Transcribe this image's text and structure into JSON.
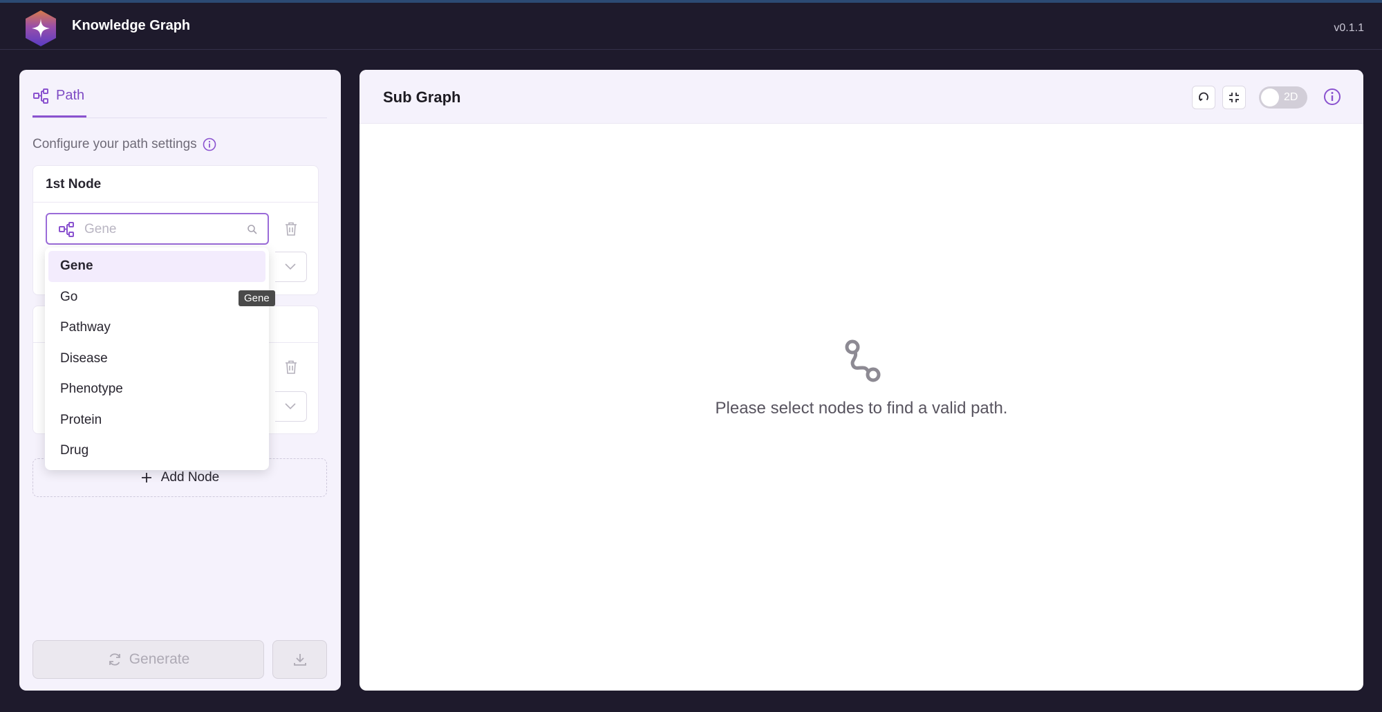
{
  "app": {
    "title": "Knowledge Graph",
    "version": "v0.1.1"
  },
  "left_panel": {
    "tab_label": "Path",
    "configure_text": "Configure your path settings",
    "node1": {
      "header": "1st Node",
      "search_placeholder": "Gene"
    },
    "add_node_label": "Add Node",
    "generate_label": "Generate"
  },
  "dropdown": {
    "items": [
      "Gene",
      "Go",
      "Pathway",
      "Disease",
      "Phenotype",
      "Protein",
      "Drug"
    ],
    "selected": "Gene",
    "tooltip": "Gene"
  },
  "right_panel": {
    "title": "Sub Graph",
    "toggle_label": "2D",
    "toggle_on": false,
    "empty_message": "Please select nodes to find a valid path."
  },
  "colors": {
    "accent": "#8a52cf",
    "background": "#1e1a2c",
    "panel": "#f5f2fc"
  }
}
